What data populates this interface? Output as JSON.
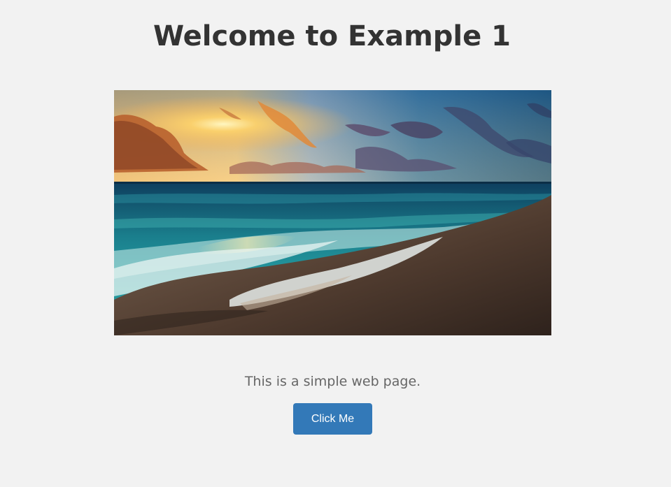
{
  "header": {
    "title": "Welcome to Example 1"
  },
  "hero_image": {
    "subject": "beach-sunset-waves",
    "colors": {
      "sky_top": "#1e5f86",
      "sky_glow": "#f6b25a",
      "sun": "#fff3b0",
      "sea": "#1f8f98",
      "foam": "#e7f2f2",
      "sand": "#5b4537"
    }
  },
  "main": {
    "description": "This is a simple web page.",
    "button_label": "Click Me"
  },
  "colors": {
    "background": "#f2f2f2",
    "button": "#3379b8",
    "heading": "#333333",
    "body_text": "#666666"
  }
}
